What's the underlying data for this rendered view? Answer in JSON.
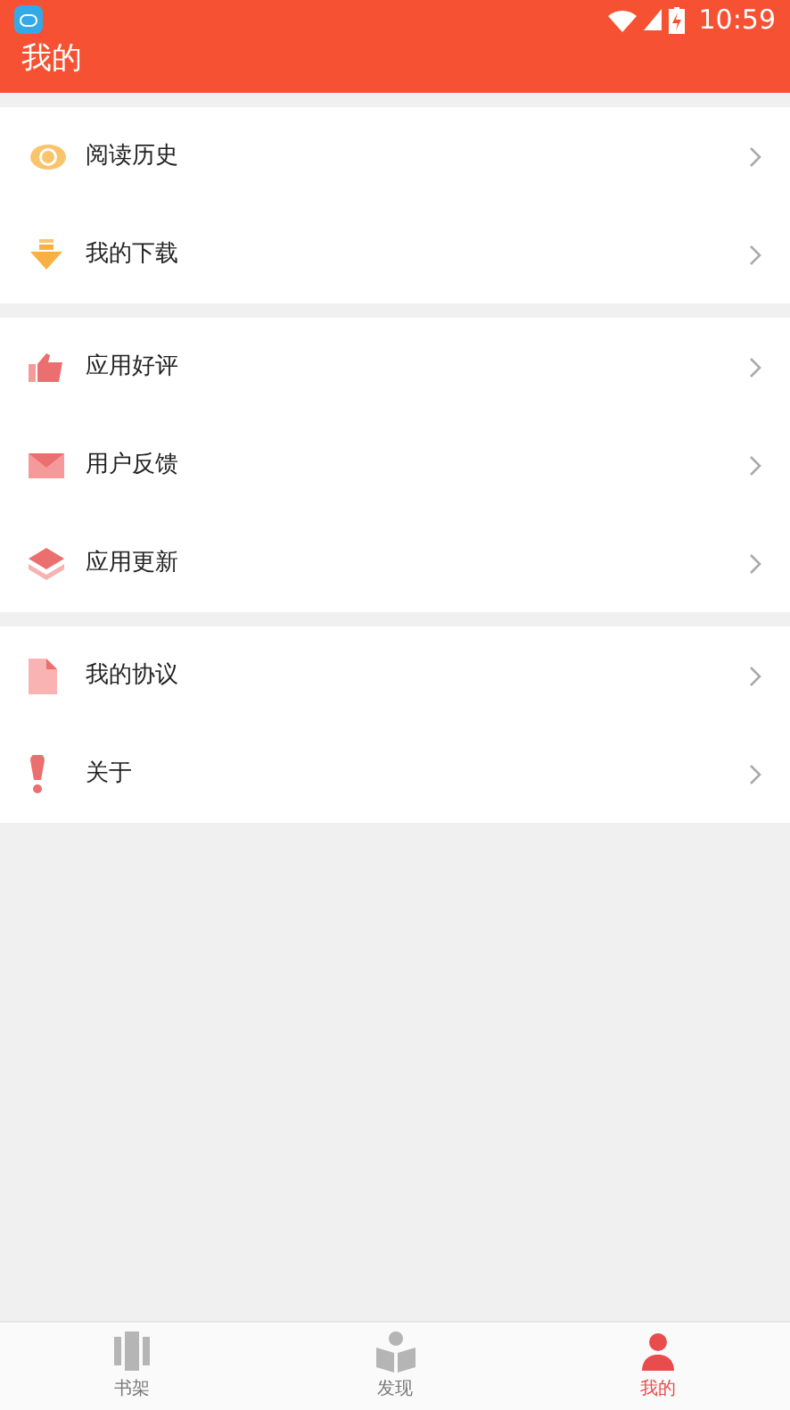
{
  "status_bar": {
    "time": "10:59"
  },
  "header": {
    "title": "我的"
  },
  "groups": [
    {
      "items": [
        {
          "label": "阅读历史"
        },
        {
          "label": "我的下载"
        }
      ]
    },
    {
      "items": [
        {
          "label": "应用好评"
        },
        {
          "label": "用户反馈"
        },
        {
          "label": "应用更新"
        }
      ]
    },
    {
      "items": [
        {
          "label": "我的协议"
        },
        {
          "label": "关于"
        }
      ]
    }
  ],
  "bottom_nav": [
    {
      "label": "书架",
      "selected": false
    },
    {
      "label": "发现",
      "selected": false
    },
    {
      "label": "我的",
      "selected": true
    }
  ]
}
